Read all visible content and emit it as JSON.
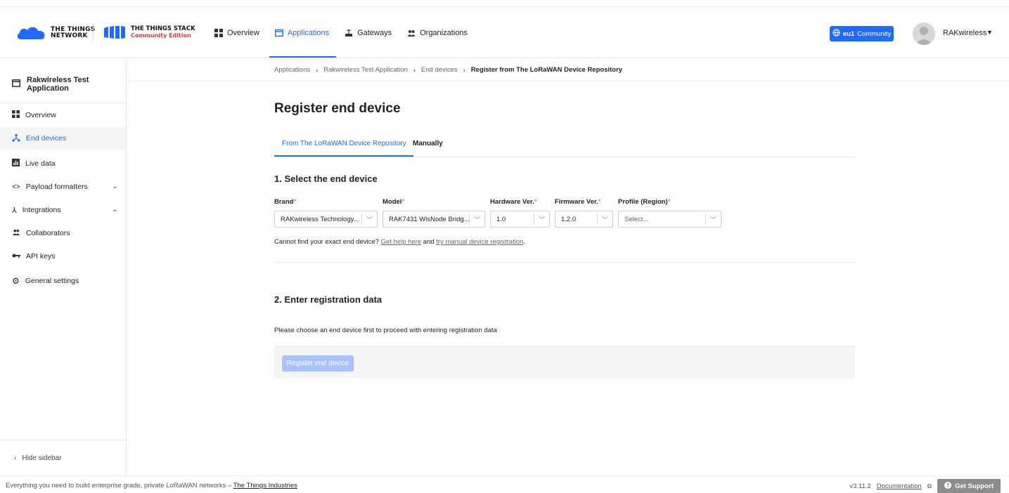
{
  "header": {
    "ttn_logo_line1": "THE THINGS",
    "ttn_logo_line2": "NETWORK",
    "tts_logo_line1": "THE THINGS STACK",
    "tts_logo_line2": "Community Edition",
    "nav": [
      {
        "label": "Overview",
        "icon": "grid-icon"
      },
      {
        "label": "Applications",
        "icon": "application-icon",
        "active": true
      },
      {
        "label": "Gateways",
        "icon": "gateway-icon"
      },
      {
        "label": "Organizations",
        "icon": "organizations-icon"
      }
    ],
    "cluster_region": "eu1",
    "cluster_label": "Community",
    "user_name": "RAKwireless",
    "accent_color": "#1e6bff"
  },
  "sidebar": {
    "app_name": "Rakwireless Test Application",
    "items": [
      {
        "label": "Overview",
        "icon": "grid-icon"
      },
      {
        "label": "End devices",
        "icon": "devices-icon",
        "active": true
      },
      {
        "label": "Live data",
        "icon": "chart-icon"
      },
      {
        "label": "Payload formatters",
        "icon": "code-icon",
        "expandable": true
      },
      {
        "label": "Integrations",
        "icon": "integrations-icon",
        "expandable": true
      },
      {
        "label": "Collaborators",
        "icon": "collaborators-icon"
      },
      {
        "label": "API keys",
        "icon": "key-icon"
      },
      {
        "label": "General settings",
        "icon": "gear-icon"
      }
    ],
    "hide_label": "Hide sidebar"
  },
  "breadcrumb": [
    "Applications",
    "Rakwireless Test Application",
    "End devices",
    "Register from The LoRaWAN Device Repository"
  ],
  "main": {
    "title": "Register end device",
    "tabs": [
      "From The LoRaWAN Device Repository",
      "Manually"
    ],
    "section1_title": "1. Select the end device",
    "fields": {
      "brand": {
        "label": "Brand",
        "value": "RAKwireless Technology..."
      },
      "model": {
        "label": "Model",
        "value": "RAK7431 WisNode Bridg..."
      },
      "hardware": {
        "label": "Hardware Ver.",
        "value": "1.0"
      },
      "firmware": {
        "label": "Firmware Ver.",
        "value": "1.2.0"
      },
      "profile": {
        "label": "Profile (Region)",
        "placeholder": "Select..."
      }
    },
    "help_prefix": "Cannot find your exact end device?",
    "help_link1": "Get help here",
    "help_mid": "and",
    "help_link2": "try manual device registration",
    "help_suffix": ".",
    "section2_title": "2. Enter registration data",
    "section2_info": "Please choose an end device first to proceed with entering registration data",
    "submit_label": "Register end device"
  },
  "footer": {
    "tagline": "Everything you need to build enterprise grade, private LoRaWAN networks –",
    "company_link": "The Things Industries",
    "version": "v3.11.2",
    "docs_link": "Documentation",
    "support_label": "Get Support"
  }
}
